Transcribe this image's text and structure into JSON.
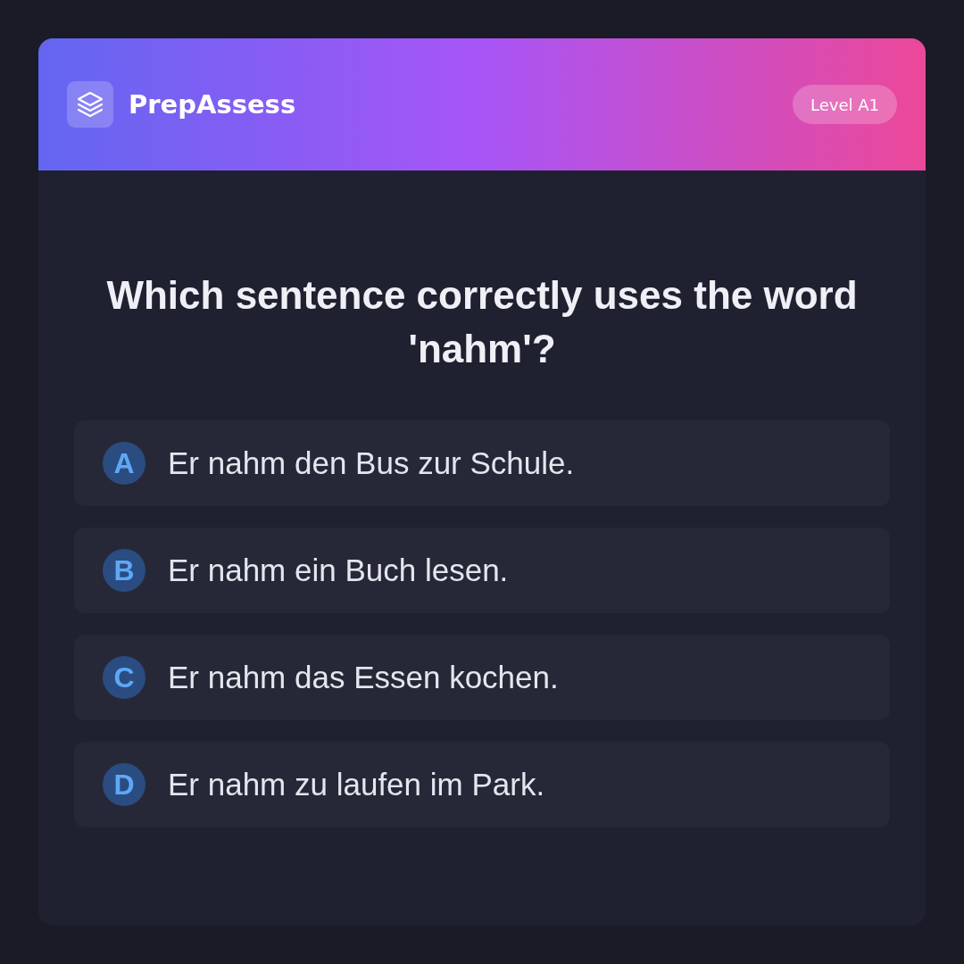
{
  "header": {
    "brand": "PrepAssess",
    "level_badge": "Level A1"
  },
  "question": {
    "text": "Which sentence correctly uses the word 'nahm'?"
  },
  "options": [
    {
      "letter": "A",
      "text": "Er nahm den Bus zur Schule."
    },
    {
      "letter": "B",
      "text": "Er nahm ein Buch lesen."
    },
    {
      "letter": "C",
      "text": "Er nahm das Essen kochen."
    },
    {
      "letter": "D",
      "text": "Er nahm zu laufen im Park."
    }
  ]
}
